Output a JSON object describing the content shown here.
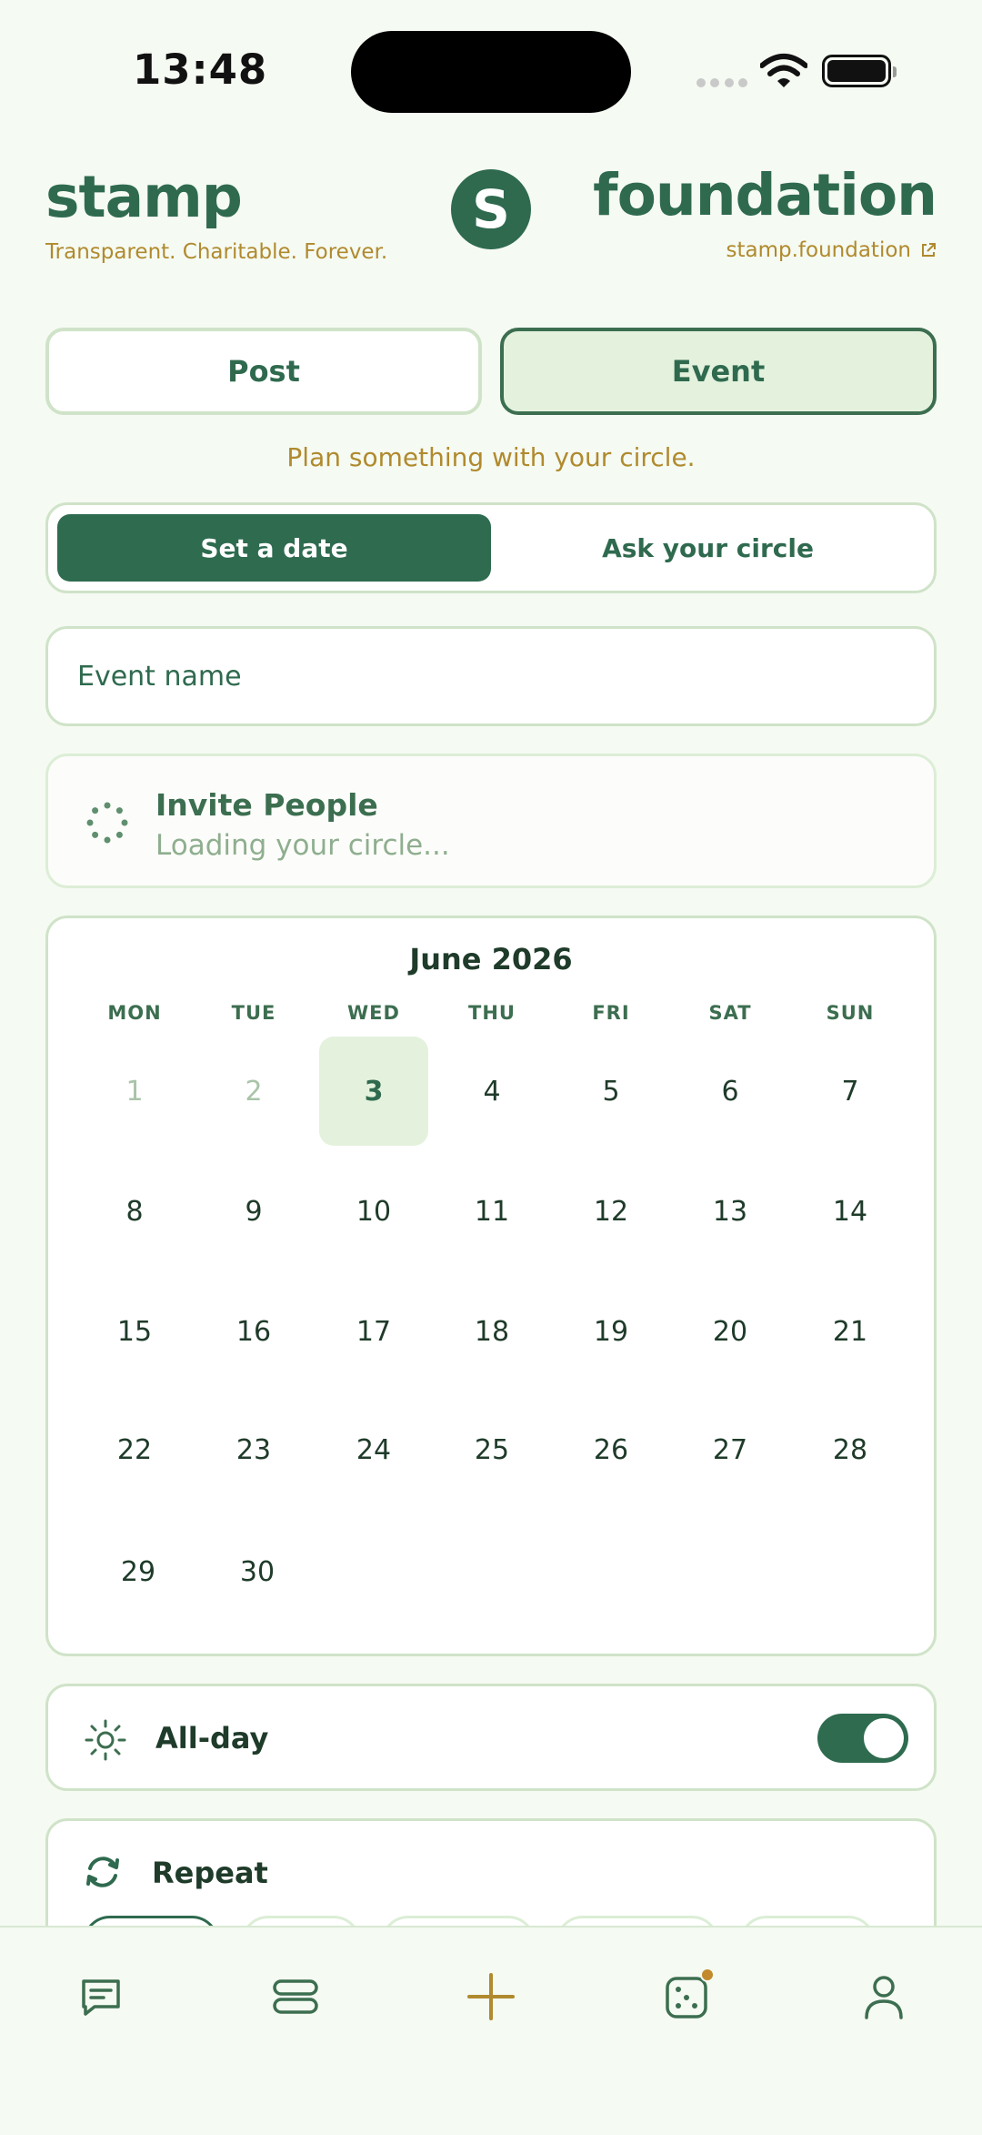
{
  "status_bar": {
    "time": "13:48"
  },
  "brand": {
    "left_name": "stamp",
    "tagline": "Transparent. Charitable. Forever.",
    "logo_letter": "S",
    "right_name": "foundation",
    "link": "stamp.foundation"
  },
  "type_toggle": {
    "post_label": "Post",
    "event_label": "Event",
    "selected": "Event"
  },
  "subtitle": "Plan something with your circle.",
  "mode": {
    "set_date_label": "Set a date",
    "ask_label": "Ask your circle",
    "selected": "Set a date"
  },
  "event_name": {
    "placeholder": "Event name",
    "value": ""
  },
  "invite": {
    "title": "Invite People",
    "status": "Loading your circle..."
  },
  "calendar": {
    "month_label": "June 2026",
    "weekdays": [
      "MON",
      "TUE",
      "WED",
      "THU",
      "FRI",
      "SAT",
      "SUN"
    ],
    "weeks": [
      [
        "1",
        "2",
        "3",
        "4",
        "5",
        "6",
        "7"
      ],
      [
        "8",
        "9",
        "10",
        "11",
        "12",
        "13",
        "14"
      ],
      [
        "15",
        "16",
        "17",
        "18",
        "19",
        "20",
        "21"
      ],
      [
        "22",
        "23",
        "24",
        "25",
        "26",
        "27",
        "28"
      ],
      [
        "29",
        "30"
      ]
    ],
    "past_days": [
      "1",
      "2"
    ],
    "selected_day": "3"
  },
  "all_day": {
    "label": "All-day",
    "enabled": true
  },
  "repeat": {
    "label": "Repeat"
  },
  "bottom_nav": [
    {
      "icon": "chat-icon"
    },
    {
      "icon": "feed-icon"
    },
    {
      "icon": "plus-icon"
    },
    {
      "icon": "dice-icon",
      "badge": true
    },
    {
      "icon": "profile-icon"
    }
  ],
  "colors": {
    "background": "#f5faf2",
    "brand_green": "#2f6a4f",
    "accent_gold": "#b08a2e",
    "border": "#cfe3c8",
    "selected_fill": "#e4f2dd"
  }
}
